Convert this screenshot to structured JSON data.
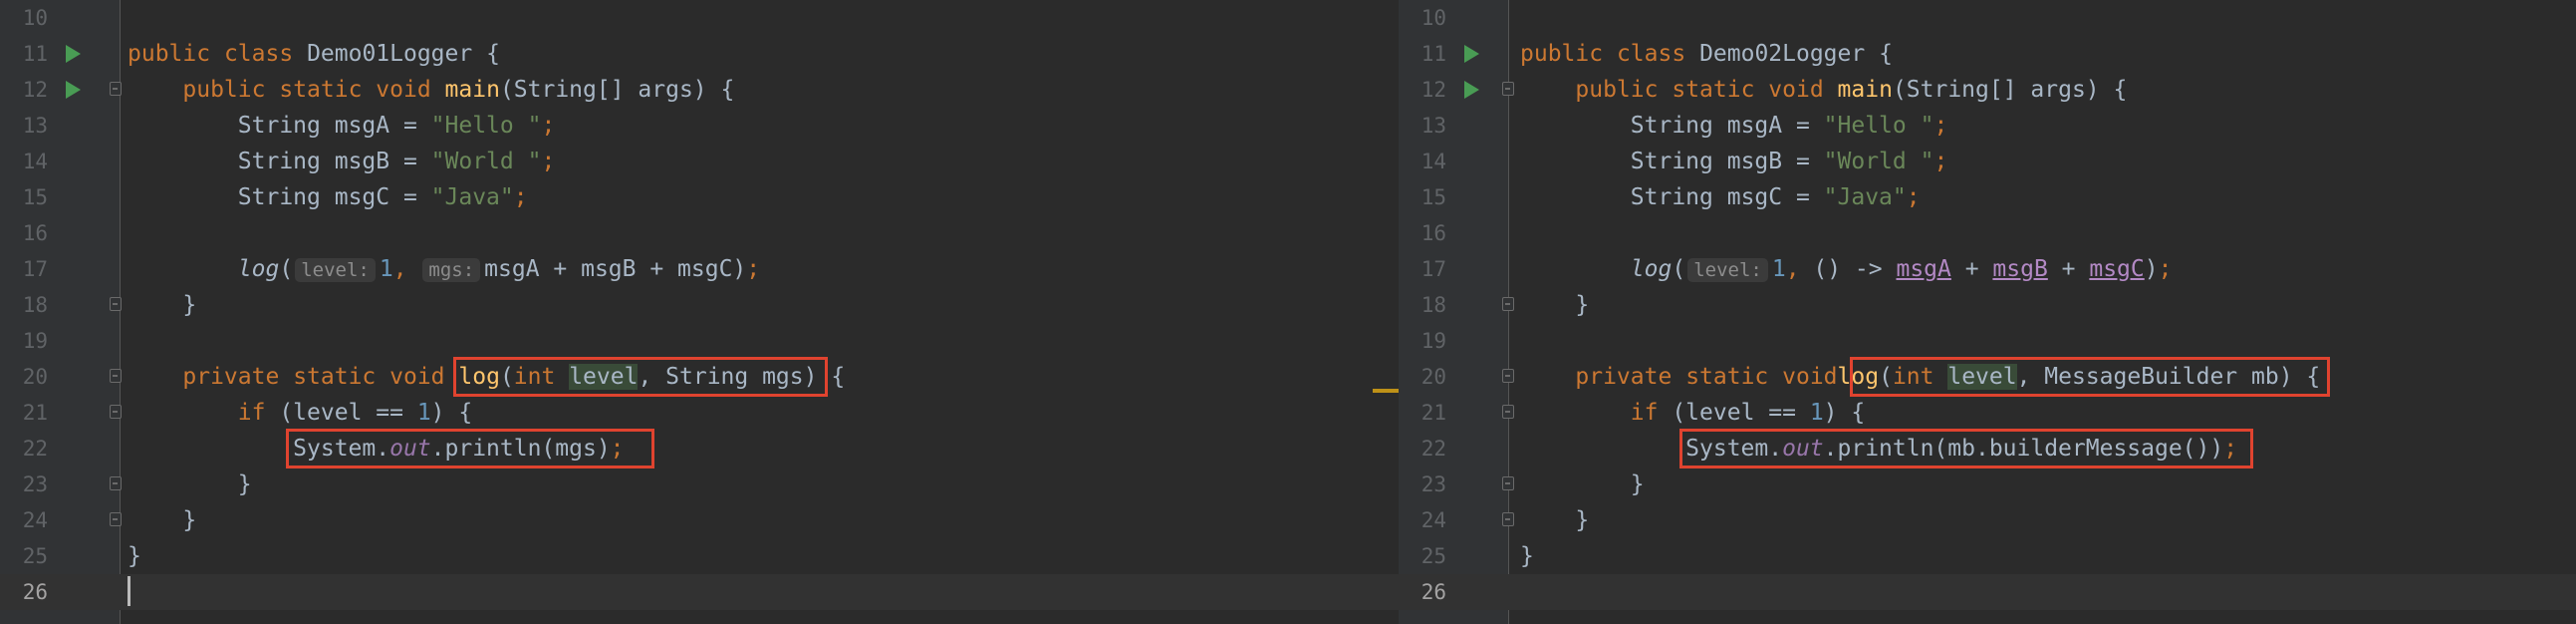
{
  "left_editor": {
    "line_numbers": [
      "10",
      "11",
      "12",
      "13",
      "14",
      "15",
      "16",
      "17",
      "18",
      "19",
      "20",
      "21",
      "22",
      "23",
      "24",
      "25",
      "26"
    ],
    "t": {
      "public": "public",
      "class": "class",
      "class_name": "Demo01Logger",
      "open_brace": " {",
      "static": "static",
      "void": "void",
      "main": "main",
      "main_params": "(String[] args) {",
      "string_type": "String",
      "msgA_decl": "msgA = ",
      "msgB_decl": "msgB = ",
      "msgC_decl": "msgC = ",
      "str_hello": "\"Hello \"",
      "str_world": "\"World \"",
      "str_java": "\"Java\"",
      "semicolon": ";",
      "log": "log",
      "open_paren": "(",
      "hint_level": "level:",
      "one": "1",
      "comma": ",",
      "hint_mgs": "mgs:",
      "concat_expr": "msgA + msgB + msgC)",
      "close_brace": "}",
      "private": "private",
      "int": "int",
      "level": "level",
      "param_rest": ", String mgs)",
      "if_kw": "if",
      "if_cond": " (level == ",
      "if_close": ") {",
      "system": "System.",
      "out": "out",
      "println_call": ".println(mgs)"
    }
  },
  "right_editor": {
    "line_numbers": [
      "10",
      "11",
      "12",
      "13",
      "14",
      "15",
      "16",
      "17",
      "18",
      "19",
      "20",
      "21",
      "22",
      "23",
      "24",
      "25",
      "26"
    ],
    "t": {
      "public": "public",
      "class": "class",
      "class_name": "Demo02Logger",
      "open_brace": " {",
      "static": "static",
      "void": "void",
      "main": "main",
      "main_params": "(String[] args) {",
      "string_type": "String",
      "msgA_decl": "msgA = ",
      "msgB_decl": "msgB = ",
      "msgC_decl": "msgC = ",
      "str_hello": "\"Hello \"",
      "str_world": "\"World \"",
      "str_java": "\"Java\"",
      "semicolon": ";",
      "log": "log",
      "open_paren": "(",
      "hint_level": "level:",
      "one": "1",
      "comma": ",",
      "lambda": " () -> ",
      "msgA": "msgA",
      "msgB": "msgB",
      "msgC": "msgC",
      "plus": " + ",
      "close_paren": ")",
      "close_brace": "}",
      "private": "private",
      "int": "int",
      "level": "level",
      "param_rest": ", MessageBuilder mb)",
      "if_kw": "if",
      "if_cond": " (level == ",
      "if_close": ") {",
      "system": "System.",
      "out": "out",
      "println_call": ".println(mb.builderMessage())"
    }
  },
  "colors": {
    "background": "#2b2b2b",
    "keyword": "#cc7832",
    "method": "#ffc66d",
    "string": "#6a8759",
    "number": "#6897bb",
    "static_field": "#9876aa",
    "highlight_box": "#e0432f"
  }
}
